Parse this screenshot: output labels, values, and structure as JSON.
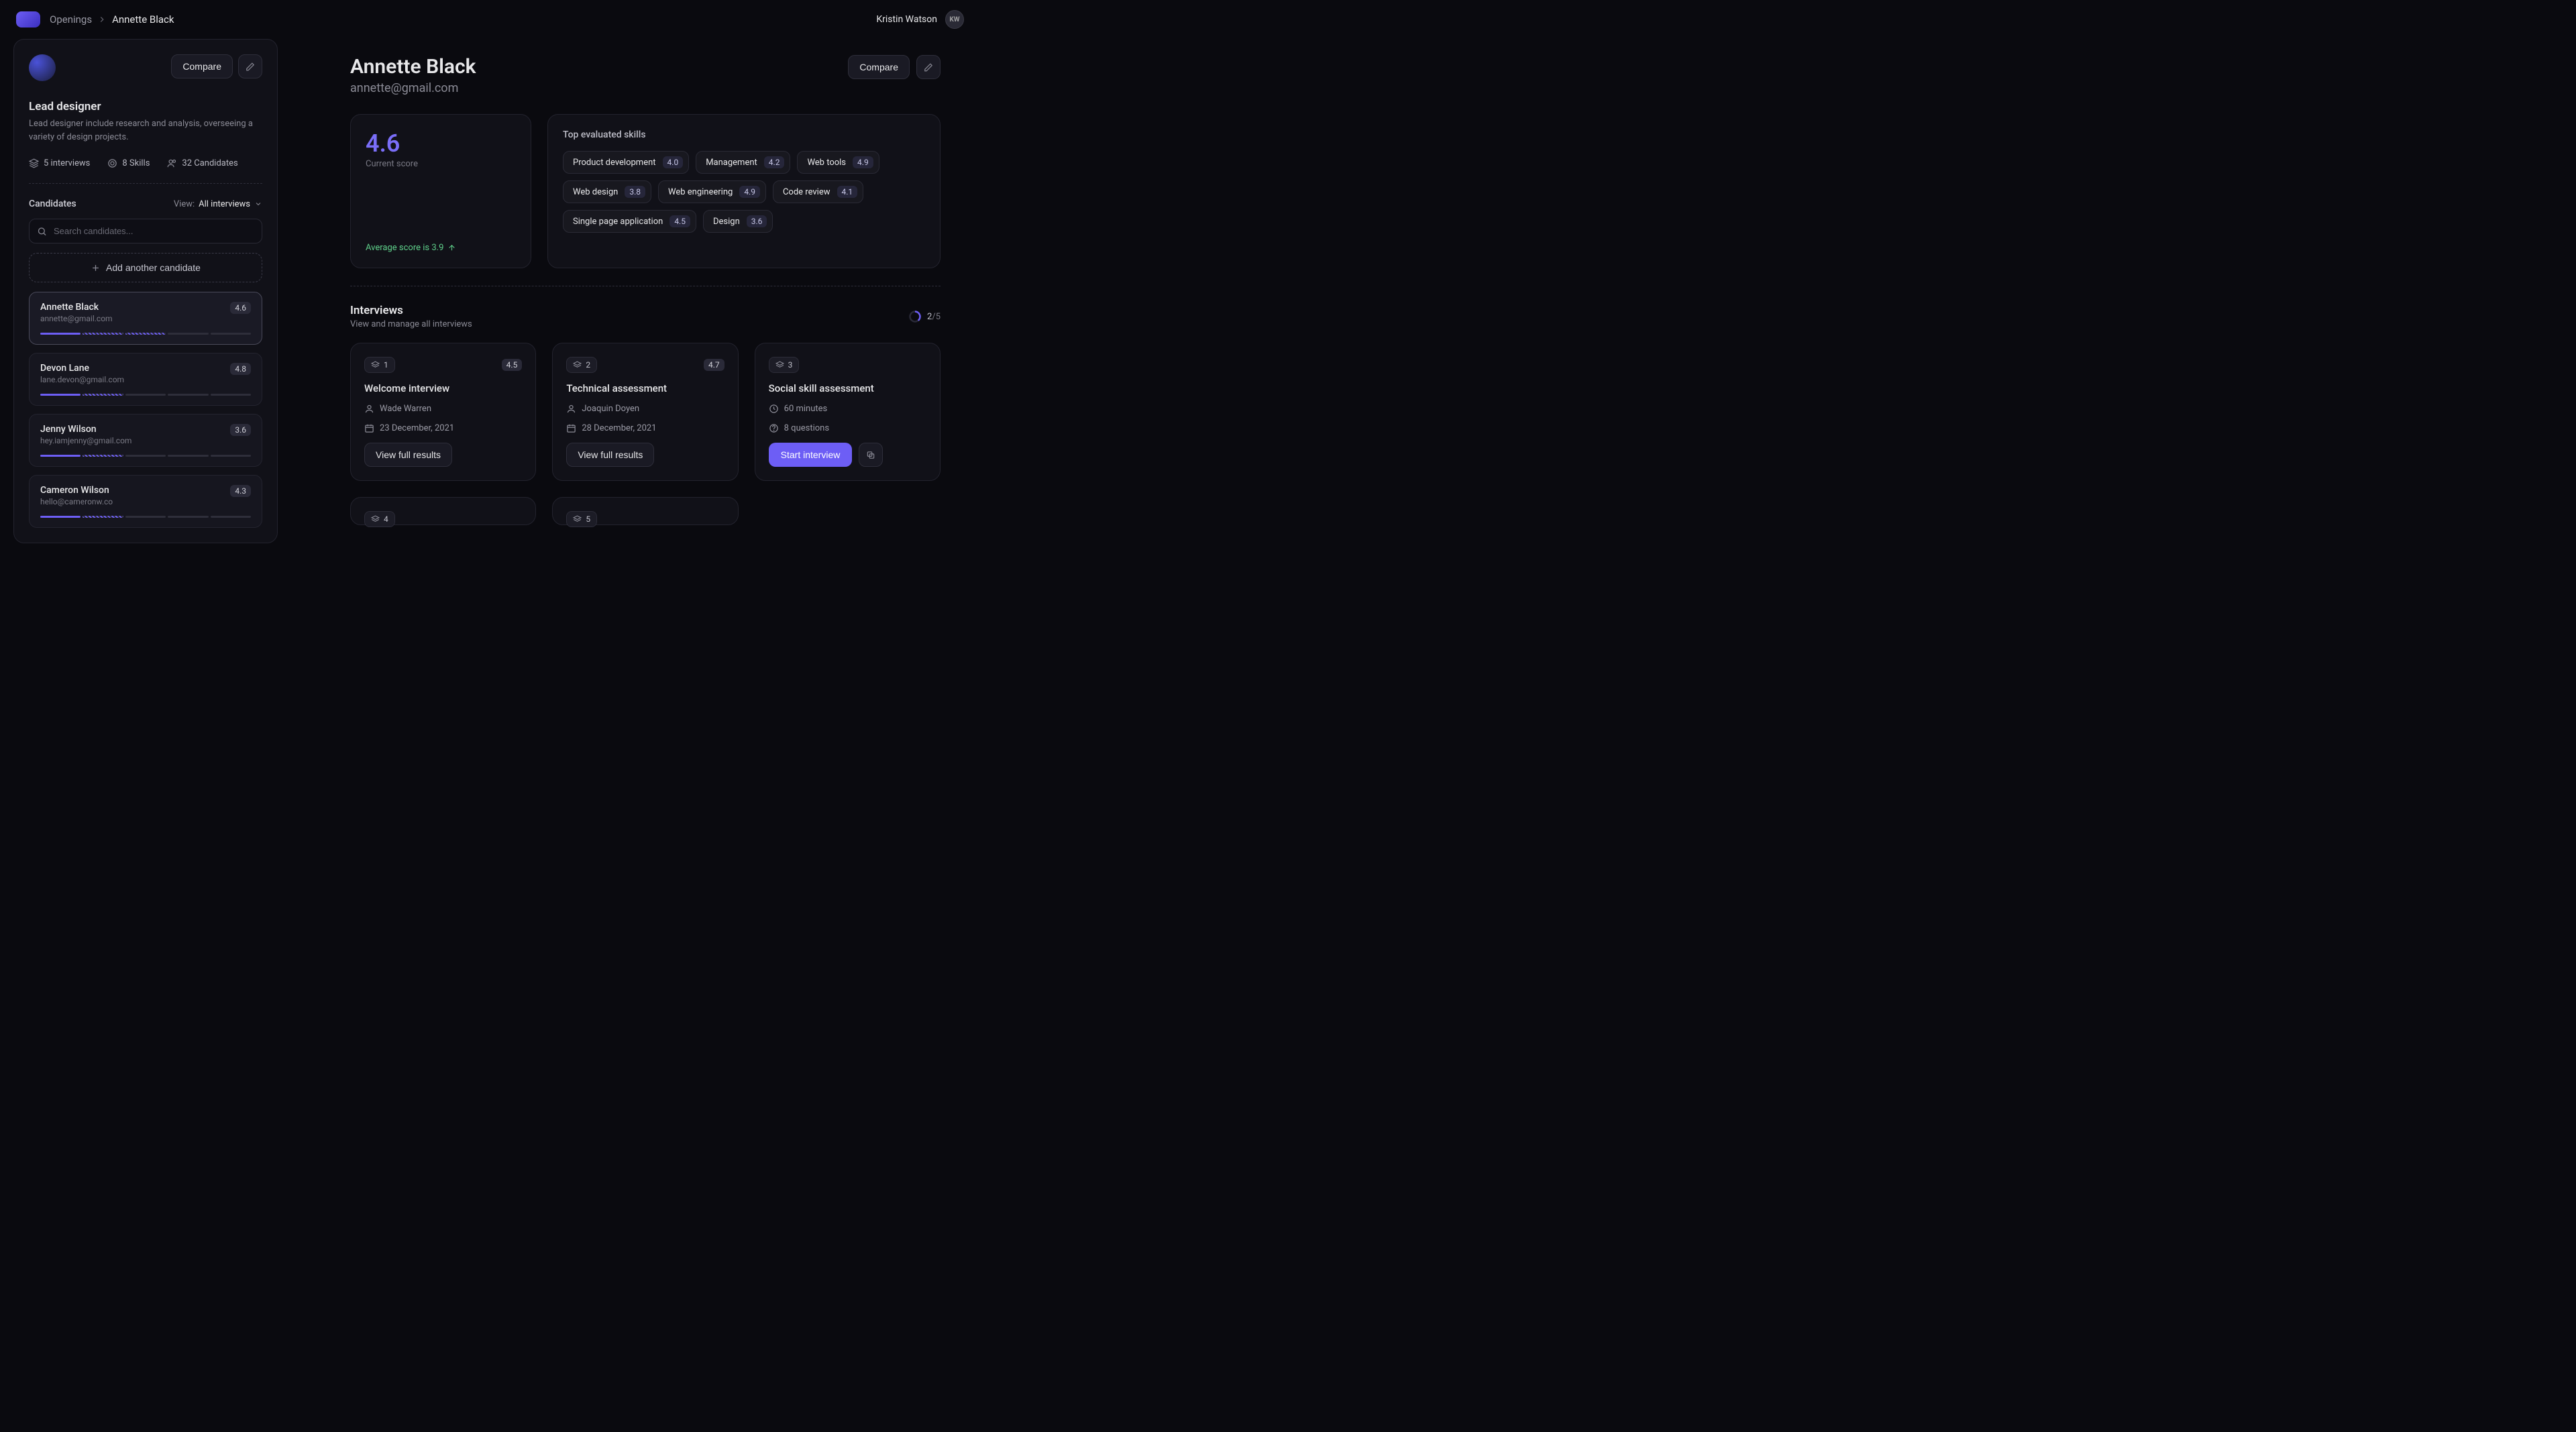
{
  "header": {
    "breadcrumb_root": "Openings",
    "breadcrumb_current": "Annette Black",
    "user_name": "Kristin Watson",
    "user_initials": "KW"
  },
  "role_panel": {
    "compare_label": "Compare",
    "title": "Lead designer",
    "description": "Lead designer include research and analysis, overseeing a variety of design projects.",
    "stats": {
      "interviews": "5 interviews",
      "skills": "8 Skills",
      "candidates": "32 Candidates"
    }
  },
  "candidates_panel": {
    "heading": "Candidates",
    "view_label": "View:",
    "view_value": "All interviews",
    "search_placeholder": "Search candidates...",
    "add_label": "Add another candidate",
    "items": [
      {
        "name": "Annette Black",
        "email": "annette@gmail.com",
        "score": "4.6",
        "filled": 1,
        "hatch": 2,
        "selected": true
      },
      {
        "name": "Devon Lane",
        "email": "lane.devon@gmail.com",
        "score": "4.8",
        "filled": 1,
        "hatch": 1,
        "selected": false
      },
      {
        "name": "Jenny Wilson",
        "email": "hey.iamjenny@gmail.com",
        "score": "3.6",
        "filled": 1,
        "hatch": 1,
        "selected": false
      },
      {
        "name": "Cameron Wilson",
        "email": "hello@cameronw.co",
        "score": "4.3",
        "filled": 1,
        "hatch": 1,
        "selected": false
      }
    ]
  },
  "detail": {
    "name": "Annette Black",
    "email": "annette@gmail.com",
    "compare_label": "Compare",
    "score": {
      "value": "4.6",
      "label": "Current score",
      "avg_text": "Average score is 3.9"
    },
    "skills_heading": "Top evaluated skills",
    "skills": [
      {
        "label": "Product development",
        "value": "4.0"
      },
      {
        "label": "Management",
        "value": "4.2"
      },
      {
        "label": "Web tools",
        "value": "4.9"
      },
      {
        "label": "Web design",
        "value": "3.8"
      },
      {
        "label": "Web engineering",
        "value": "4.9"
      },
      {
        "label": "Code review",
        "value": "4.1"
      },
      {
        "label": "Single page application",
        "value": "4.5"
      },
      {
        "label": "Design",
        "value": "3.6"
      }
    ]
  },
  "interviews": {
    "heading": "Interviews",
    "subheading": "View and manage all interviews",
    "progress_done": "2",
    "progress_total": "/5",
    "cards": [
      {
        "step": "1",
        "score": "4.5",
        "title": "Welcome interview",
        "person": "Wade Warren",
        "date": "23 December, 2021",
        "action": "View full results"
      },
      {
        "step": "2",
        "score": "4.7",
        "title": "Technical assessment",
        "person": "Joaquin Doyen",
        "date": "28 December, 2021",
        "action": "View full results"
      },
      {
        "step": "3",
        "score": "",
        "title": "Social skill assessment",
        "duration": "60 minutes",
        "questions": "8 questions",
        "primary_action": "Start interview"
      }
    ],
    "stubs": [
      {
        "step": "4"
      },
      {
        "step": "5"
      }
    ]
  }
}
